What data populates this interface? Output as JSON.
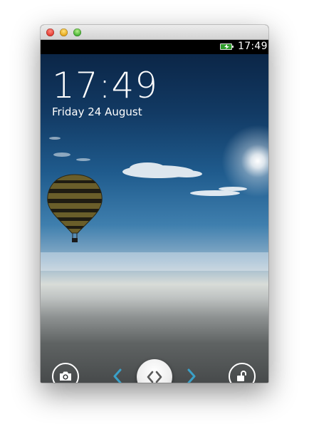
{
  "window": {
    "controls": [
      "close",
      "minimize",
      "zoom"
    ]
  },
  "statusbar": {
    "time": "17:49",
    "battery_icon": "battery-charging-icon",
    "battery_color": "#2e9c2a"
  },
  "lockscreen": {
    "time": "17:49",
    "date": "Friday 24 August"
  },
  "controls": {
    "camera_icon": "camera-icon",
    "slider_icon": "chevrons-left-right-icon",
    "unlock_icon": "unlock-icon",
    "arrow_color": "#3aa0c8"
  }
}
